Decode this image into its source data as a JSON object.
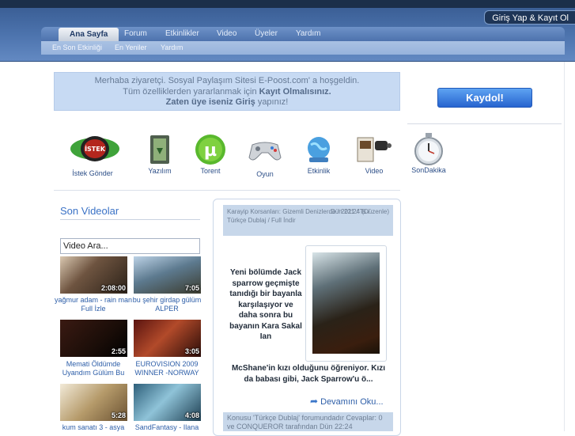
{
  "header": {
    "login_label": "Giriş Yap & Kayıt Ol",
    "nav_tabs": [
      {
        "label": "Ana Sayfa",
        "active": true
      },
      {
        "label": "Forum",
        "active": false
      },
      {
        "label": "Etkinlikler",
        "active": false
      },
      {
        "label": "Video",
        "active": false
      },
      {
        "label": "Üyeler",
        "active": false
      },
      {
        "label": "Yardım",
        "active": false
      }
    ],
    "sub_tabs": [
      "En Son Etkinliği",
      "En Yeniler",
      "Yardım"
    ]
  },
  "welcome": {
    "line1": "Merhaba ziyaretçi. Sosyal Paylaşım Sitesi E-Poost.com' a hoşgeldin.",
    "line2_prefix": "Tüm özelliklerden yararlanmak için",
    "line2_bold": "Kayıt Olmalısınız.",
    "line3_bold": "Zaten üye iseniz Giriş",
    "line3_suffix": "yapınız!"
  },
  "register_button": "Kaydol!",
  "quick_links": [
    {
      "label": "İstek Gönder",
      "icon": "request-icon"
    },
    {
      "label": "Yazılım",
      "icon": "software-folder-icon"
    },
    {
      "label": "Torent",
      "icon": "torrent-icon"
    },
    {
      "label": "Oyun",
      "icon": "gamepad-icon"
    },
    {
      "label": "Etkinlik",
      "icon": "globe-icon"
    },
    {
      "label": "Video",
      "icon": "video-camera-icon"
    },
    {
      "label": "SonDakika",
      "icon": "stopwatch-icon"
    }
  ],
  "videos_section": {
    "title": "Son Videolar",
    "search_placeholder": "Video Ara...",
    "items": [
      {
        "title": "yağmur adam - rain man Full İzle",
        "duration": "2:08:00"
      },
      {
        "title": "bu şehir girdap gülüm ALPER",
        "duration": "7:05"
      },
      {
        "title": "Memati Öldümde Uyandım Gülüm Bu",
        "duration": "2:55"
      },
      {
        "title": "EUROVISION 2009 WINNER -NORWAY",
        "duration": "3:05"
      },
      {
        "title": "kum sanatı 3 - asya",
        "duration": "5:28"
      },
      {
        "title": "SandFantasy - Ilana",
        "duration": "4:08"
      }
    ]
  },
  "post": {
    "title": "Karayip Korsanları: Gizemli Denizlerde / 2011 / Ts / Türkçe Dublaj / Full İndir",
    "date": "Dün 22:24",
    "edited": "(Düzenle)",
    "body_part1": "Yeni bölümde Jack sparrow geçmişte tanıdığı bir bayanla karşılaşıyor ve daha sonra bu bayanın Kara Sakal Ian",
    "body_part2": "McShane'in kızı olduğunu öğreniyor. Kızı da babası gibi, Jack Sparrow'u ö...",
    "read_more": "Devamını Oku...",
    "footer": "Konusu 'Türkçe Dublaj' forumundadır Cevaplar: 0 ve CONQUEROR tarafından Dün 22:24"
  },
  "colors": {
    "header_band": "#4c73ad",
    "accent_blue": "#2d5ea8",
    "register_button": "#2764cf",
    "welcome_bg": "#c7daf3"
  }
}
